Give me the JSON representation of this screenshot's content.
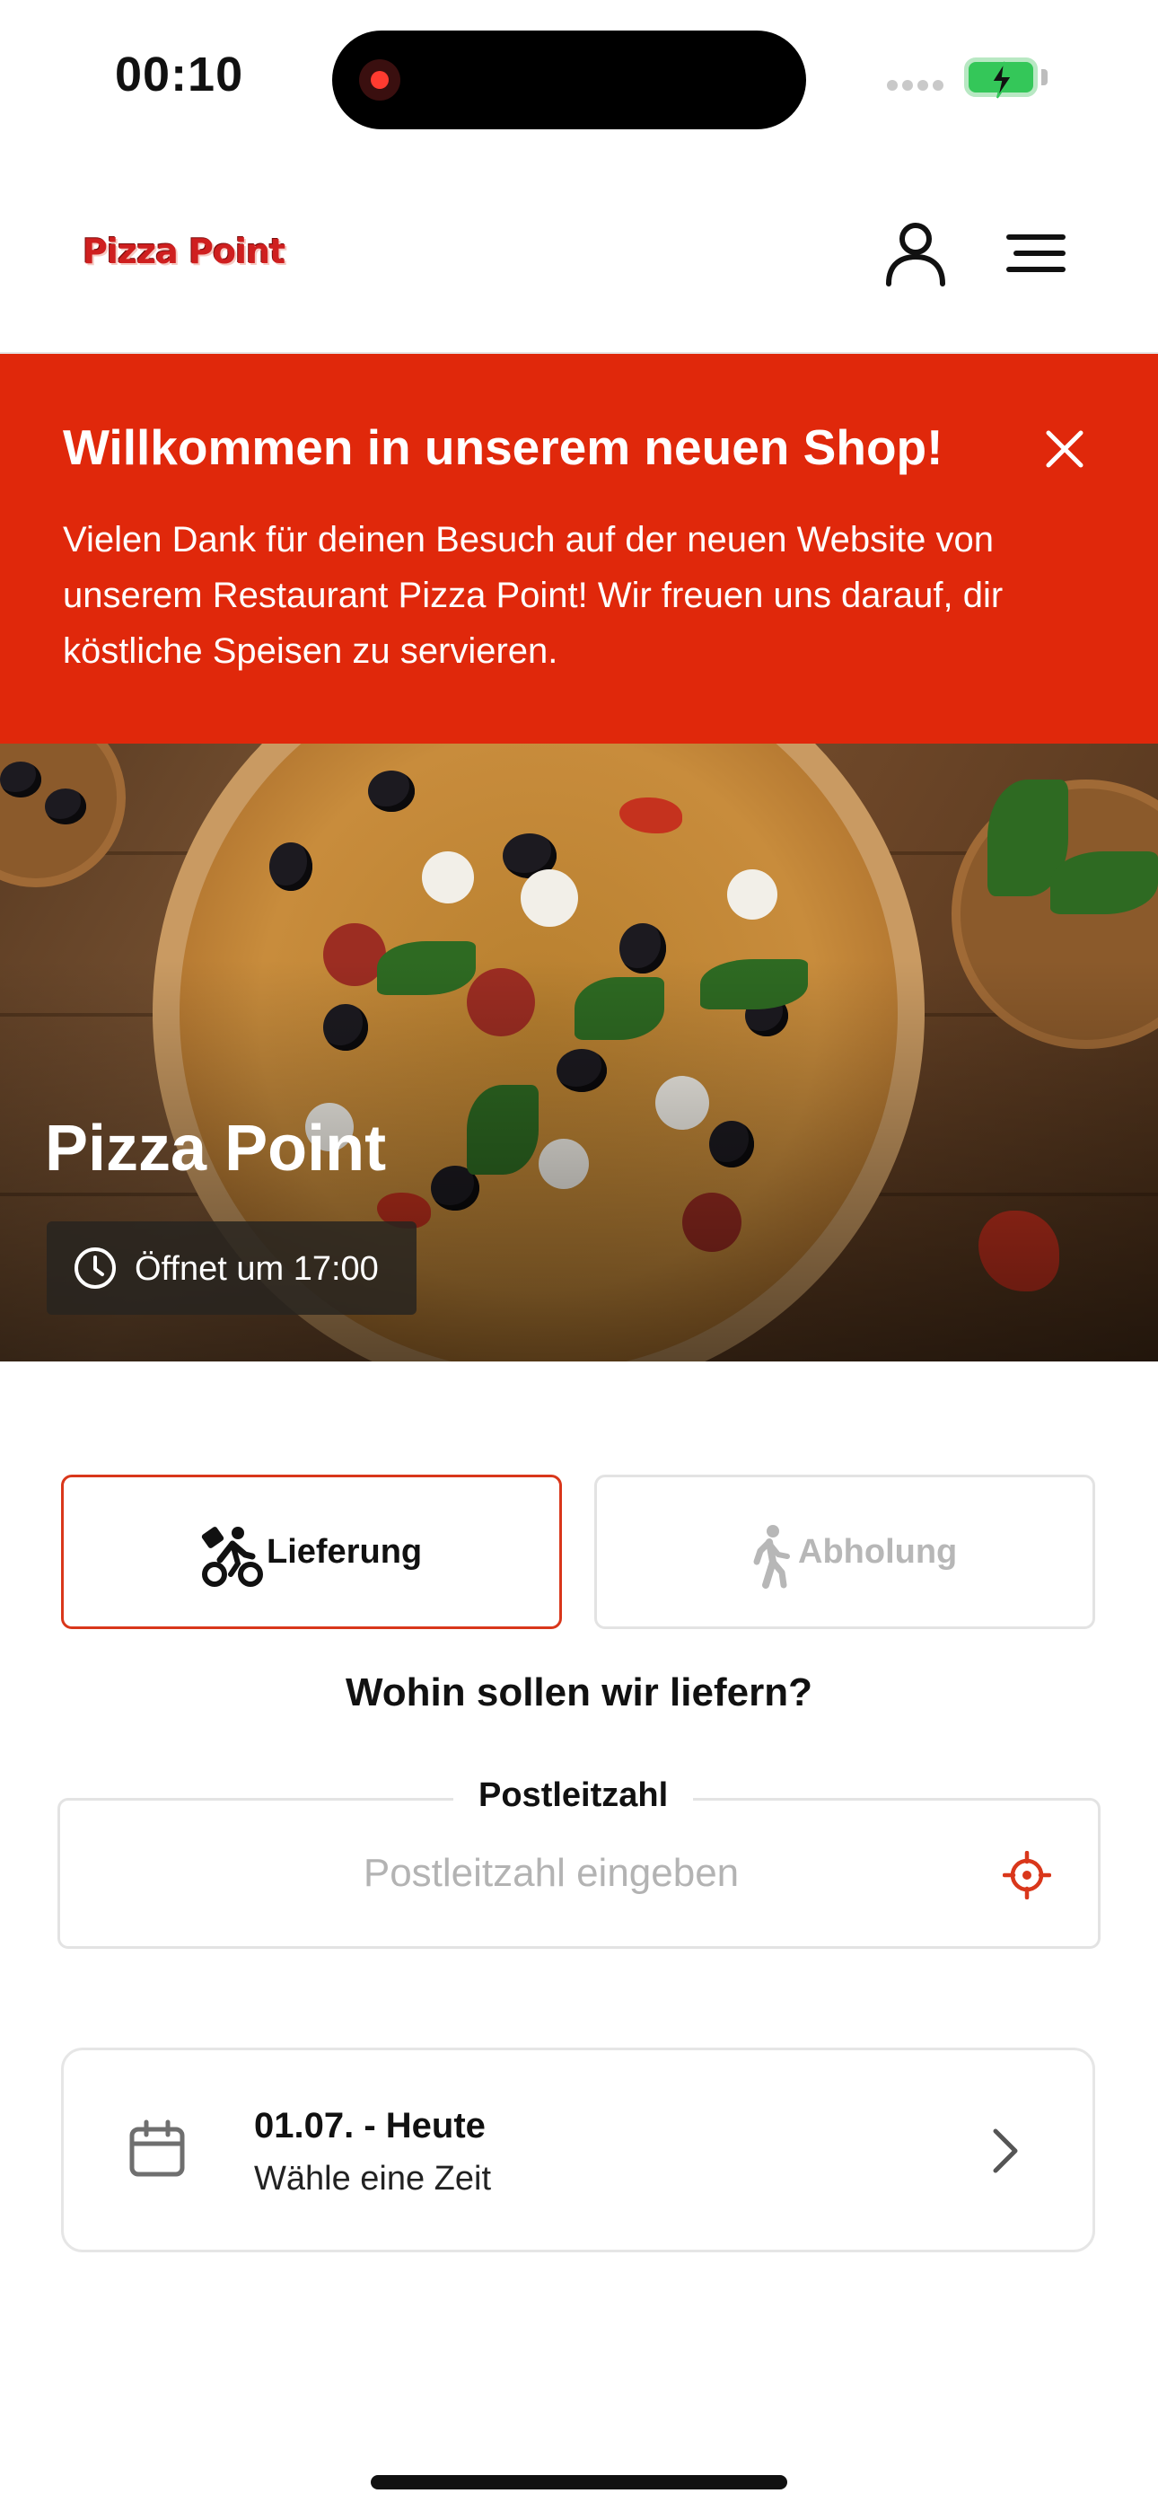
{
  "status_bar": {
    "time": "00:10"
  },
  "header": {
    "logo_text": "Pizza Point",
    "user_icon": "user-icon",
    "menu_icon": "hamburger-menu-icon"
  },
  "welcome_banner": {
    "title": "Willkommen in unserem neuen Shop!",
    "text": "Vielen Dank für deinen Besuch auf der neuen Website von unserem Restaurant Pizza Point! Wir freuen uns darauf, dir köstliche Speisen zu servieren.",
    "background_color": "#e0280b",
    "close_icon": "close-icon"
  },
  "hero": {
    "restaurant_name": "Pizza Point",
    "hours_label": "Öffnet um 17:00",
    "clock_icon": "clock-icon"
  },
  "order_mode": {
    "delivery_label": "Lieferung",
    "pickup_label": "Abholung",
    "selected": "Lieferung",
    "accent_color": "#d9371b"
  },
  "delivery_question": "Wohin sollen wir liefern?",
  "postal_code": {
    "label": "Postleitzahl",
    "value": "",
    "placeholder": "Postleitzahl eingeben",
    "locate_icon": "crosshair-icon"
  },
  "date_selector": {
    "date_label": "01.07. - Heute",
    "time_hint": "Wähle eine Zeit",
    "calendar_icon": "calendar-icon",
    "chevron_icon": "chevron-right-icon"
  }
}
